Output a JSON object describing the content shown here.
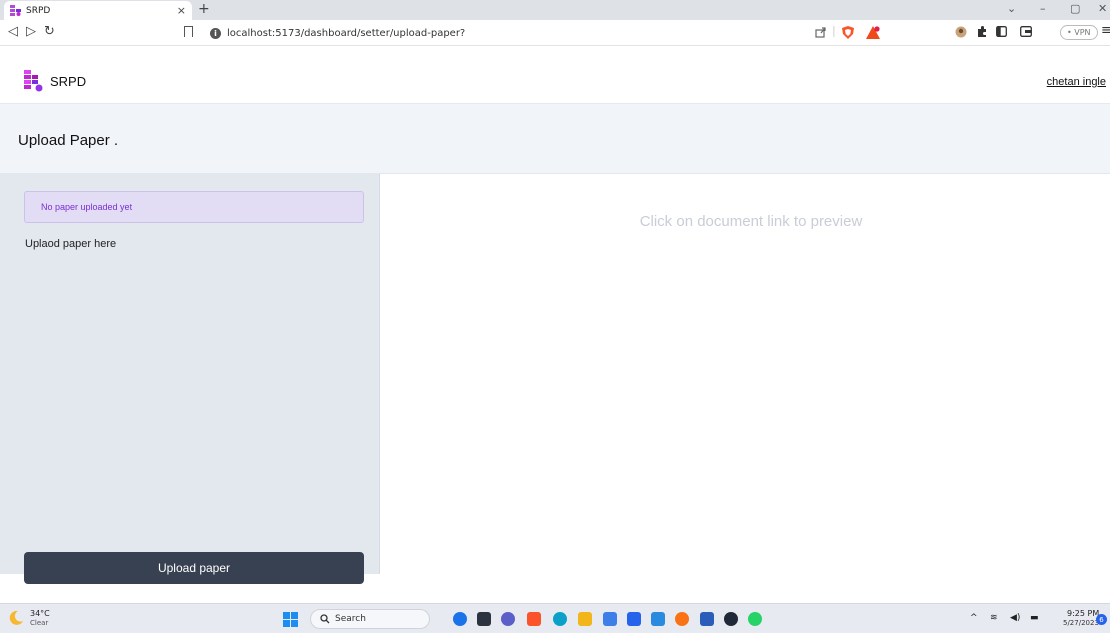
{
  "browser": {
    "tab_title": "SRPD",
    "tab_close": "×",
    "new_tab": "+",
    "url": "localhost:5173/dashboard/setter/upload-paper?",
    "vpn_label": "• VPN"
  },
  "app": {
    "brand_name": "SRPD",
    "user_name": "chetan ingle",
    "page_title": "Upload Paper .",
    "alert_text": "No paper uploaded yet",
    "upload_hint": "Uplaod paper here",
    "upload_button_label": "Upload paper",
    "preview_placeholder": "Click on document link to preview"
  },
  "taskbar": {
    "weather_temp": "34°C",
    "weather_condition": "Clear",
    "search_label": "Search",
    "clock_time": "9:25 PM",
    "clock_date": "5/27/2023",
    "notification_count": "6"
  },
  "colors": {
    "accent_purple": "#7b2fd6",
    "button_dark": "#374151",
    "sidebar_bg": "#e3e7ee",
    "alert_bg": "#e3dcf5"
  }
}
